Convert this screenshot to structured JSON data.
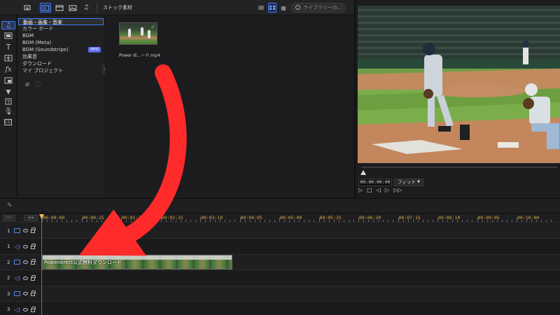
{
  "toolbar": {
    "stock_label": "ストック素材",
    "search_placeholder": "ライブラリーの…"
  },
  "categories": [
    {
      "label": "動画・画像・音楽",
      "selected": true
    },
    {
      "label": "カラー ボード"
    },
    {
      "label": "BGM"
    },
    {
      "label": "BGM (Meta)"
    },
    {
      "label": "BGM (Soundstripe)",
      "badge": "NEW"
    },
    {
      "label": "効果音"
    },
    {
      "label": "ダウンロード"
    },
    {
      "label": "マイ プロジェクト"
    }
  ],
  "media": {
    "filename": "Power di...ード.mp4"
  },
  "preview": {
    "timecode": "00:00:00:00",
    "fit_label": "フィット"
  },
  "ruler": {
    "ticks": [
      "00:00:00",
      "00:00:25",
      "00:01:20",
      "00:02:15",
      "00:03:10",
      "00:04:05",
      "00:05:00",
      "00:05:25",
      "00:06:20",
      "00:07:15",
      "00:08:10",
      "00:09:05",
      "00:10:00"
    ]
  },
  "tracks": [
    {
      "num": "1",
      "type": "video"
    },
    {
      "num": "1",
      "type": "audio"
    },
    {
      "num": "2",
      "type": "video"
    },
    {
      "num": "2",
      "type": "audio"
    },
    {
      "num": "3",
      "type": "video"
    },
    {
      "num": "3",
      "type": "audio"
    }
  ],
  "clip": {
    "label": "Powerdirect公式無料ダウンロード"
  },
  "colors": {
    "accent": "#3d7bff",
    "playhead": "#e0443a",
    "timecode": "#d8a94c",
    "annotation_arrow": "#ff2a2a"
  }
}
